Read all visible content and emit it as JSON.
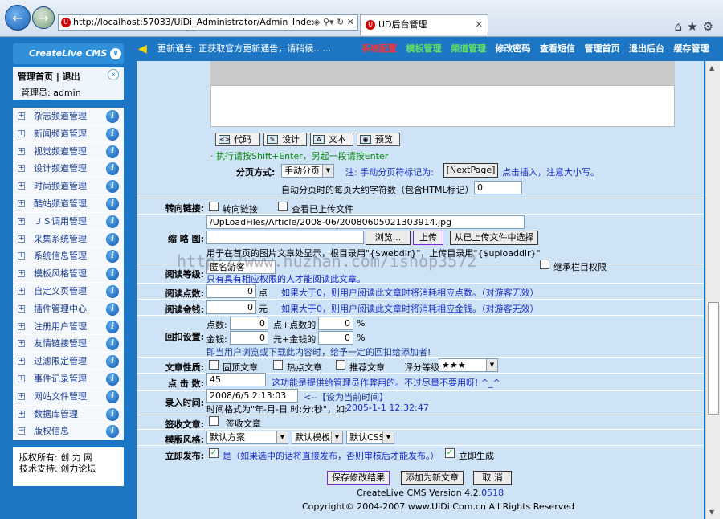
{
  "browser": {
    "url": "http://localhost:57033/UiDi_Administrator/Admin_Inde:",
    "tab_title": "UD后台管理",
    "colors": {
      "accent": "#1c76c4"
    }
  },
  "sidebar": {
    "logo": "CreateLive CMS",
    "admin_links": "管理首页 | 退出",
    "admin_user": "管理员: admin",
    "items": [
      {
        "label": "杂志频道管理"
      },
      {
        "label": "新闻频道管理"
      },
      {
        "label": "视觉频道管理"
      },
      {
        "label": "设计频道管理"
      },
      {
        "label": "时尚频道管理"
      },
      {
        "label": "酷站频道管理"
      },
      {
        "label": "ＪＳ调用管理"
      },
      {
        "label": "采集系统管理"
      },
      {
        "label": "系统信息管理"
      },
      {
        "label": "模板风格管理"
      },
      {
        "label": "自定义页管理"
      },
      {
        "label": "插件管理中心"
      },
      {
        "label": "注册用户管理"
      },
      {
        "label": "友情链接管理"
      },
      {
        "label": "过滤限定管理"
      },
      {
        "label": "事件记录管理"
      },
      {
        "label": "网站文件管理"
      },
      {
        "label": "数据库管理"
      },
      {
        "label": "版权信息"
      }
    ],
    "copyright_line1": "版权所有: 创 力 网",
    "copyright_line2": "技术支持: 创力论坛"
  },
  "topbar": {
    "notice": "更新通告: 正获取官方更新通告，请稍候……",
    "nav": [
      "系统配置",
      "模板管理",
      "频道管理",
      "修改密码",
      "查看短信",
      "管理首页",
      "退出后台",
      "缓存管理"
    ]
  },
  "editor": {
    "tabs": [
      "代码",
      "设计",
      "文本",
      "预览"
    ],
    "hint": "执行请按Shift+Enter，另起一段请按Enter"
  },
  "form": {
    "paging_label": "分页方式:",
    "paging_value": "手动分页",
    "paging_hint_prefix": "注: 手动分页符标记为:",
    "paging_tag_btn": "[NextPage]",
    "paging_hint_suffix": "点击插入，注意大小写。",
    "auto_paging_label": "自动分页时的每页大约字符数（包含HTML标记）:",
    "auto_paging_value": "0",
    "redirect_label": "转向链接:",
    "redirect_cb": "转向链接",
    "view_uploaded_cb": "查看已上传文件",
    "thumb_label": "缩 略 图:",
    "thumb_value": "/UpLoadFiles/Article/2008-06/20080605021303914.jpg",
    "browse_btn": "浏览...",
    "upload_btn": "上传",
    "choose_uploaded_btn": "从已上传文件中选择",
    "thumb_note": "用于在首页的图片文章处显示，根目录用\"{$webdir}\"，上传目录用\"{$uploaddir}\"",
    "read_level_label": "阅读等级:",
    "read_level_value": "匿名游客",
    "inherit_cb": "继承栏目权限",
    "read_level_note": "只有具有相应权限的人才能阅读此文章。",
    "read_points_label": "阅读点数:",
    "read_points_value": "0",
    "read_points_unit": "点",
    "read_points_note": "如果大于0，则用户阅读此文章时将消耗相应点数。（对游客无效）",
    "read_money_label": "阅读金钱:",
    "read_money_value": "0",
    "read_money_unit": "元",
    "read_money_note": "如果大于0，则用户阅读此文章时将消耗相应金钱。（对游客无效）",
    "reward_label": "回扣设置:",
    "reward_points_label": "点数:",
    "reward_points_value": "0",
    "reward_points_mid": "点+点数的",
    "reward_points_pct": "0",
    "reward_money_label": "金钱:",
    "reward_money_value": "0",
    "reward_money_mid": "元+金钱的",
    "reward_money_pct": "0",
    "pct_sign": "%",
    "reward_note": "即当用户浏览或下载此内容时，给予一定的回扣给添加者!",
    "property_label": "文章性质:",
    "prop_top": "固顶文章",
    "prop_hot": "热点文章",
    "prop_recommend": "推荐文章",
    "rating_label": "评分等级:",
    "rating_value": "★★★",
    "hits_label": "点 击 数:",
    "hits_value": "45",
    "hits_note": "这功能是提供给管理员作弊用的。不过尽量不要用呀! ^_^",
    "time_label": "录入时间:",
    "time_value": "2008/6/5 2:13:03",
    "time_now_link": "<--【设为当前时间】",
    "time_format_note": "时间格式为\"年-月-日 时:分:秒\"，如:",
    "time_example": "2005-1-1 12:32:47",
    "sign_label": "签收文章:",
    "sign_cb": "签收文章",
    "template_label": "模版风格:",
    "template_scheme": "默认方案",
    "template_tpl": "默认模板",
    "template_css": "默认CSS",
    "publish_label": "立即发布:",
    "publish_text": "是（如果选中的话将直接发布，否则审核后才能发布。）",
    "generate_cb": "立即生成"
  },
  "actions": {
    "save_label": "保存修改结果",
    "add_new_label": "添加为新文章",
    "cancel_label": "取 消"
  },
  "footer": {
    "version_prefix": "CreateLive CMS Version 4.2.",
    "version_suffix": "0518",
    "copyright": "Copyright© 2004-2007 www.UiDi.Com.cn All Rights Reserved"
  },
  "watermark": "http://www.huzhan.com/ishop3572"
}
